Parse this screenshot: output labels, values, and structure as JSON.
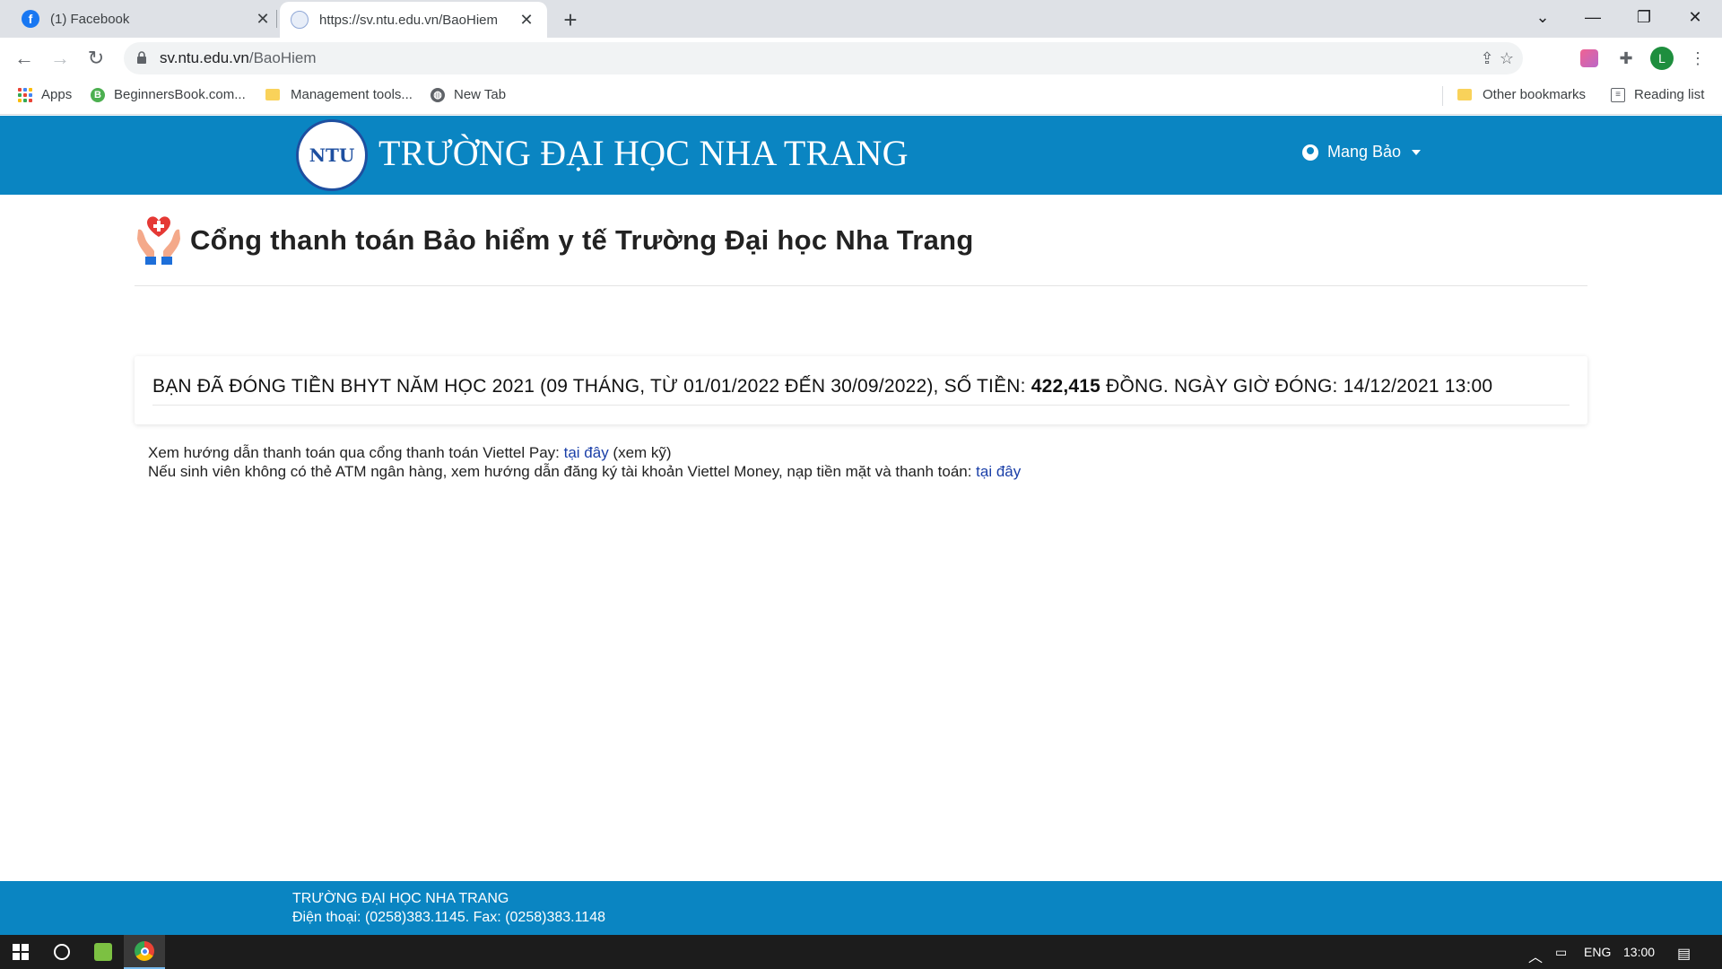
{
  "browser": {
    "tabs": [
      {
        "title": "(1) Facebook",
        "favicon": "facebook-icon"
      },
      {
        "title": "https://sv.ntu.edu.vn/BaoHiem",
        "favicon": "ntu-logo-icon",
        "active": true
      }
    ],
    "address_bar": {
      "domain": "sv.ntu.edu.vn",
      "path": "/BaoHiem"
    },
    "profile_initial": "L",
    "bookmarks": [
      {
        "label": "Apps",
        "icon": "apps-grid-icon"
      },
      {
        "label": "BeginnersBook.com...",
        "icon": "beginnersbook-icon"
      },
      {
        "label": "Management tools...",
        "icon": "folder-icon"
      },
      {
        "label": "New Tab",
        "icon": "globe-icon"
      }
    ],
    "bookmarks_right": [
      {
        "label": "Other bookmarks",
        "icon": "folder-icon"
      },
      {
        "label": "Reading list",
        "icon": "reading-list-icon"
      }
    ]
  },
  "site": {
    "logo_text": "NTU",
    "title": "TRƯỜNG ĐẠI HỌC NHA TRANG",
    "user_name": "Mang Bảo",
    "brand_color": "#0a85c2"
  },
  "main": {
    "heading": "Cổng thanh toán Bảo hiểm y tế Trường Đại học Nha Trang",
    "payment": {
      "prefix": "BẠN ĐÃ ĐÓNG TIỀN BHYT NĂM HỌC 2021 (09 THÁNG, TỪ 01/01/2022 ĐẾN 30/09/2022), SỐ TIỀN: ",
      "amount": "422,415",
      "suffix": " ĐỒNG. NGÀY GIỜ ĐÓNG: 14/12/2021 13:00"
    },
    "help_line1": {
      "text": "Xem hướng dẫn thanh toán qua cổng thanh toán Viettel Pay: ",
      "link": "tại đây",
      "after": " (xem kỹ)"
    },
    "help_line2": {
      "text": "Nếu sinh viên không có thẻ ATM ngân hàng, xem hướng dẫn đăng ký tài khoản Viettel Money, nạp tiền mặt và thanh toán: ",
      "link": "tại đây"
    }
  },
  "footer": {
    "line1": "TRƯỜNG ĐẠI HỌC NHA TRANG",
    "line2": "Điện thoại: (0258)383.1145. Fax: (0258)383.1148"
  },
  "taskbar": {
    "language": "ENG",
    "time": "13:00"
  }
}
